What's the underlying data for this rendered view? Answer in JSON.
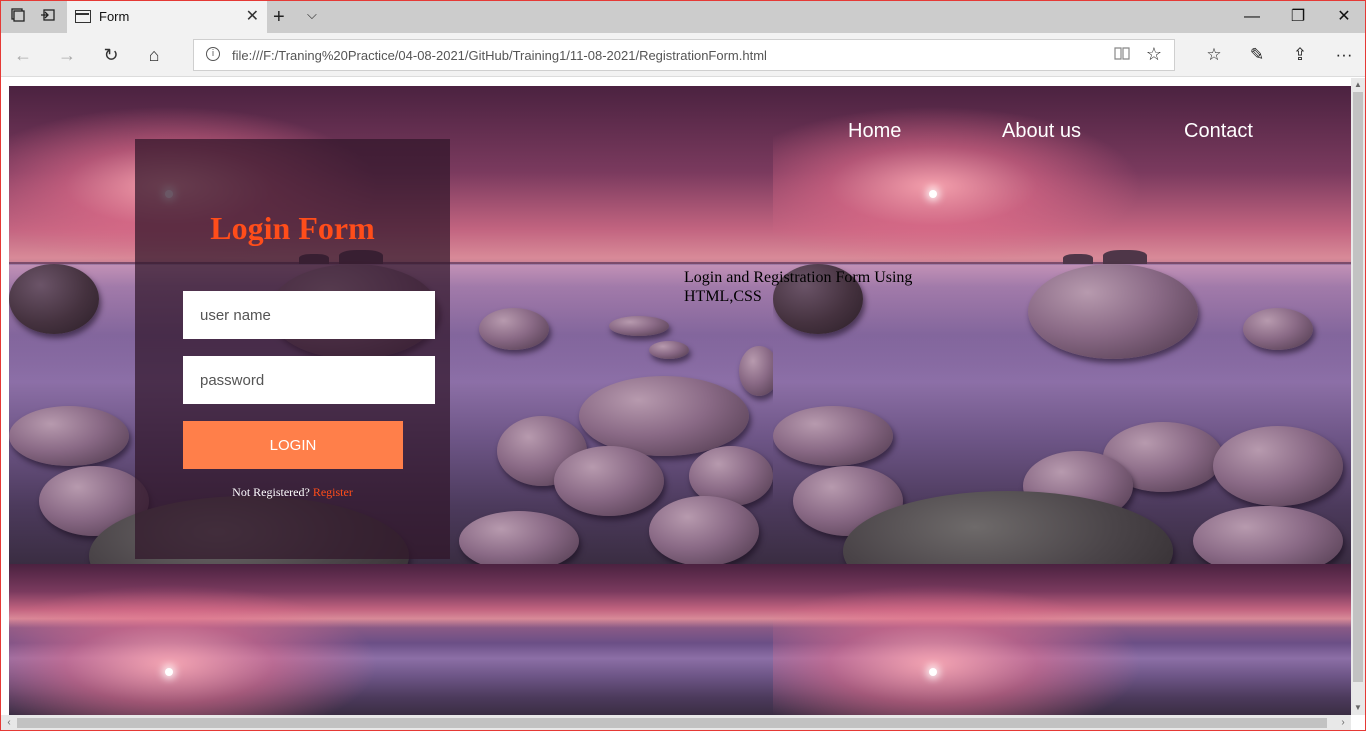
{
  "browser": {
    "tab_title": "Form",
    "url": "file:///F:/Traning%20Practice/04-08-2021/GitHub/Training1/11-08-2021/RegistrationForm.html",
    "icons": {
      "tab_actions": "tab-actions-icon",
      "set_aside": "set-aside-tabs-icon",
      "new_tab": "+",
      "tab_menu": "⌵",
      "minimize": "—",
      "maximize": "❐",
      "close": "✕",
      "back": "←",
      "forward": "→",
      "refresh": "↻",
      "home": "⌂",
      "reading_view": "📖",
      "favorite": "☆",
      "favorites_hub": "☆",
      "notes": "✎",
      "share": "⇪",
      "more": "···"
    }
  },
  "nav": {
    "home": "Home",
    "about": "About us",
    "contact": "Contact"
  },
  "caption": "Login and Registration Form Using HTML,CSS",
  "login": {
    "title": "Login Form",
    "username_placeholder": "user name",
    "password_placeholder": "password",
    "button": "LOGIN",
    "not_registered": "Not Registered?",
    "register_link": "Register"
  },
  "colors": {
    "title": "#ff4d1a",
    "button": "#ff7f4a",
    "panel": "rgba(48,22,42,0.72)",
    "window_border": "#e53935"
  }
}
